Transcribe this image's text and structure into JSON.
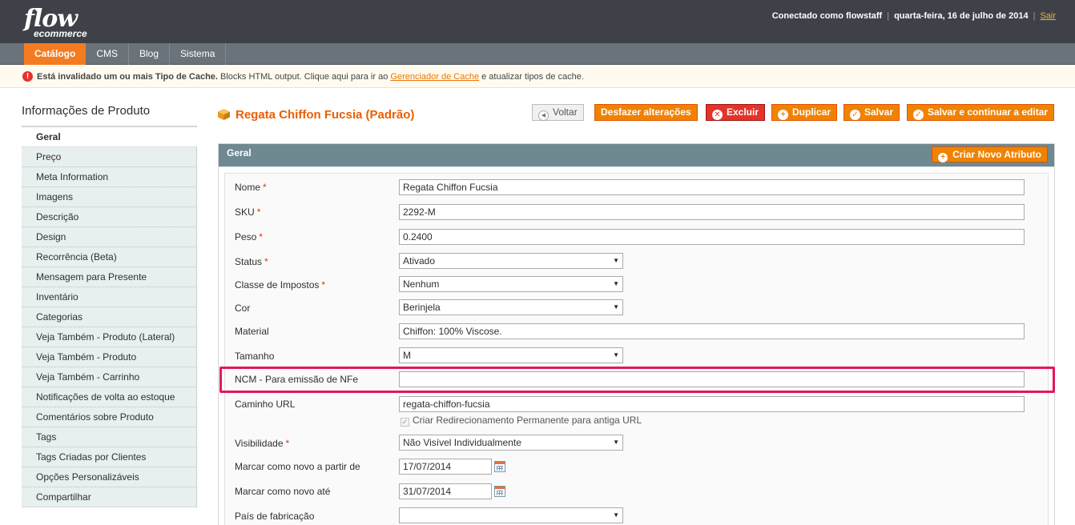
{
  "header": {
    "logo_main": "flow",
    "logo_sub": "ecommerce",
    "user_text": "Conectado como flowstaff",
    "date_text": "quarta-feira, 16 de julho de 2014",
    "separator": "|",
    "logout": "Sair"
  },
  "nav": {
    "items": [
      {
        "label": "Catálogo",
        "active": true
      },
      {
        "label": "CMS",
        "active": false
      },
      {
        "label": "Blog",
        "active": false
      },
      {
        "label": "Sistema",
        "active": false
      }
    ]
  },
  "notice": {
    "icon": "!",
    "bold_text": "Está invalidado um ou mais Tipo de Cache.",
    "text_before": " Blocks HTML output. Clique aqui para ir ao ",
    "link": "Gerenciador de Cache",
    "text_after": " e atualizar tipos de cache."
  },
  "sidebar": {
    "title": "Informações de Produto",
    "items": [
      "Geral",
      "Preço",
      "Meta Information",
      "Imagens",
      "Descrição",
      "Design",
      "Recorrência (Beta)",
      "Mensagem para Presente",
      "Inventário",
      "Categorias",
      "Veja Também - Produto (Lateral)",
      "Veja Também - Produto",
      "Veja Também - Carrinho",
      "Notificações de volta ao estoque",
      "Comentários sobre Produto",
      "Tags",
      "Tags Criadas por Clientes",
      "Opções Personalizáveis",
      "Compartilhar"
    ]
  },
  "page": {
    "title": "Regata Chiffon Fucsia (Padrão)"
  },
  "toolbar": {
    "back": "Voltar",
    "reset": "Desfazer alterações",
    "delete": "Excluir",
    "duplicate": "Duplicar",
    "save": "Salvar",
    "save_continue": "Salvar e continuar a editar"
  },
  "panel": {
    "title": "Geral",
    "create_attribute": "Criar Novo Atributo"
  },
  "form": {
    "name": {
      "label": "Nome",
      "value": "Regata Chiffon Fucsia"
    },
    "sku": {
      "label": "SKU",
      "value": "2292-M"
    },
    "weight": {
      "label": "Peso",
      "value": "0.2400"
    },
    "status": {
      "label": "Status",
      "value": "Ativado"
    },
    "tax_class": {
      "label": "Classe de Impostos",
      "value": "Nenhum"
    },
    "color": {
      "label": "Cor",
      "value": "Berinjela"
    },
    "material": {
      "label": "Material",
      "value": "Chiffon: 100% Viscose."
    },
    "size": {
      "label": "Tamanho",
      "value": "M"
    },
    "ncm": {
      "label": "NCM - Para emissão de NFe",
      "value": ""
    },
    "url_key": {
      "label": "Caminho URL",
      "value": "regata-chiffon-fucsia"
    },
    "redirect": {
      "label": "Criar Redirecionamento Permanente para antiga URL",
      "checked": true
    },
    "visibility": {
      "label": "Visibilidade",
      "value": "Não Visível Individualmente"
    },
    "new_from": {
      "label": "Marcar como novo a partir de",
      "value": "17/07/2014"
    },
    "new_to": {
      "label": "Marcar como novo até",
      "value": "31/07/2014"
    },
    "country": {
      "label": "País de fabricação",
      "value": ""
    },
    "required_mark": "*"
  },
  "colors": {
    "accent": "#f18200",
    "title_orange": "#eb5e00",
    "header_bg": "#3e4147",
    "highlight": "#e2175f"
  }
}
